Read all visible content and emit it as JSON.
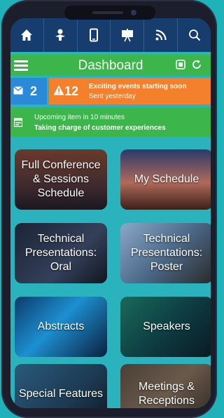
{
  "nav": {
    "icons": [
      "home-icon",
      "user-icon",
      "mobile-icon",
      "presentation-icon",
      "rss-icon",
      "search-icon"
    ]
  },
  "dashboard": {
    "title": "Dashboard"
  },
  "alerts": {
    "mail_count": "2",
    "event_count": "12",
    "event_line1": "Exciting events starting soon",
    "event_line2": "Sent yesterday"
  },
  "upcoming": {
    "line1": "Upcoming item in 10 minutes",
    "line2": "Taking charge of customer experiences"
  },
  "tiles": [
    {
      "label": "Full Conference & Sessions Schedule"
    },
    {
      "label": "My Schedule"
    },
    {
      "label": "Technical Presentations: Oral"
    },
    {
      "label": "Technical Presentations: Poster"
    },
    {
      "label": "Abstracts"
    },
    {
      "label": "Speakers"
    },
    {
      "label": "Special Features"
    },
    {
      "label": "Meetings & Receptions"
    }
  ],
  "colors": {
    "nav_bg": "#163d6e",
    "dashboard_bg": "#3cb54a",
    "mail_bg": "#2b8ad8",
    "event_bg": "#f4802b",
    "screen_bg": "#2ab3bc"
  }
}
